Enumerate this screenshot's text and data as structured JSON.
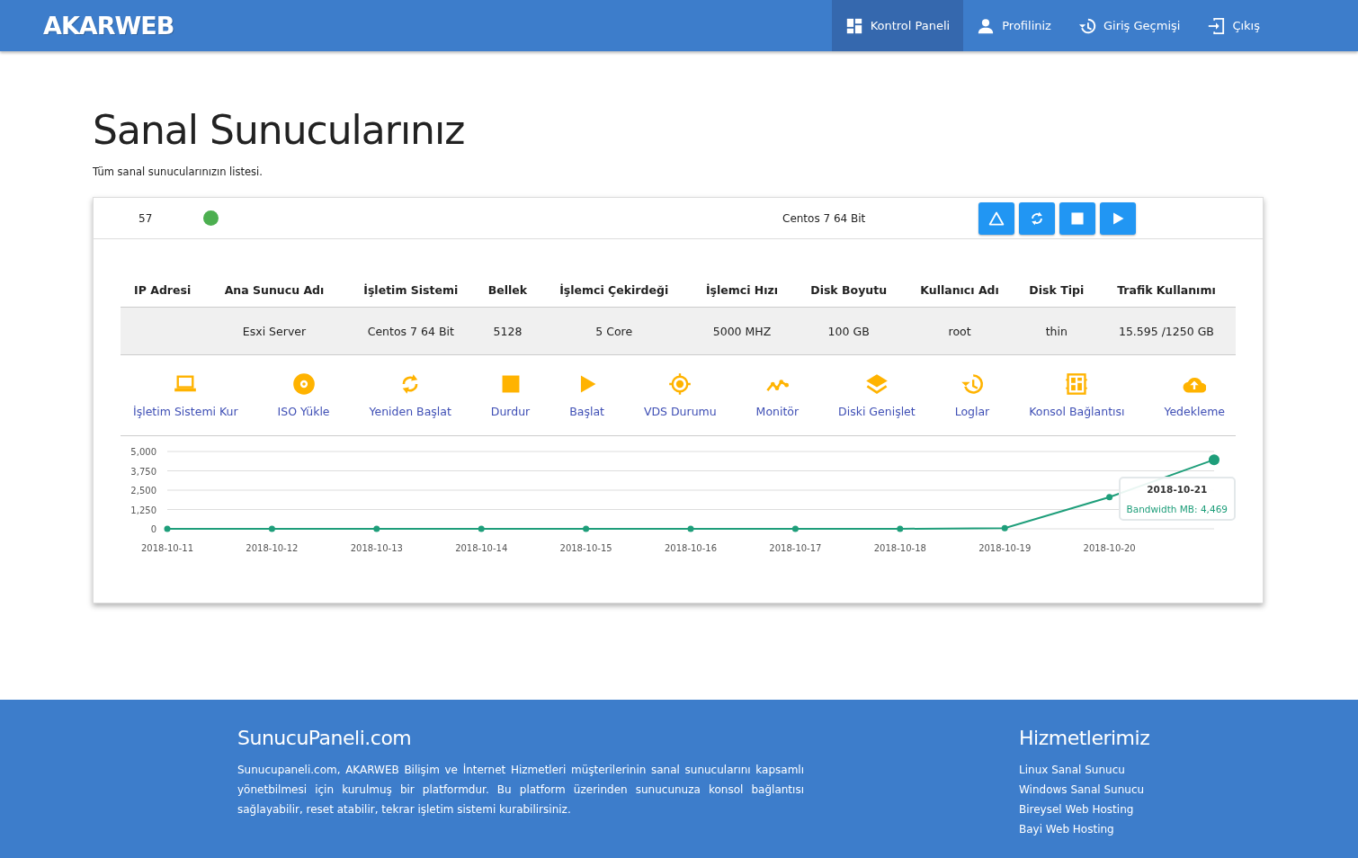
{
  "header": {
    "logo": "AKARWEB",
    "nav": [
      {
        "kind": "dashboard",
        "label": "Kontrol Paneli",
        "selected": true
      },
      {
        "kind": "person",
        "label": "Profiliniz",
        "selected": false
      },
      {
        "kind": "history",
        "label": "Giriş Geçmişi",
        "selected": false
      },
      {
        "kind": "logout",
        "label": "Çıkış",
        "selected": false
      }
    ]
  },
  "page": {
    "title": "Sanal Sunucularınız",
    "subtitle": "Tüm sanal sunucularınızın listesi."
  },
  "server": {
    "id": "57",
    "running": true,
    "os": "Centos 7 64 Bit",
    "buttons": [
      {
        "kind": "warning"
      },
      {
        "kind": "restart"
      },
      {
        "kind": "stop"
      },
      {
        "kind": "play"
      }
    ],
    "table": {
      "columns": [
        "IP Adresi",
        "Ana Sunucu Adı",
        "İşletim Sistemi",
        "Bellek",
        "İşlemci Çekirdeği",
        "İşlemci Hızı",
        "Disk Boyutu",
        "Kullanıcı Adı",
        "Disk Tipi",
        "Trafik Kullanımı"
      ],
      "row": [
        "Esxi Server",
        "Centos 7 64 Bit",
        "5128",
        "5 Core",
        "5000 MHZ",
        "100 GB",
        "root",
        "thin",
        "15.595 /1250 GB"
      ]
    },
    "actions": [
      {
        "kind": "laptop",
        "label": "İşletim Sistemi Kur"
      },
      {
        "kind": "disc",
        "label": "ISO Yükle"
      },
      {
        "kind": "restart",
        "label": "Yeniden Başlat"
      },
      {
        "kind": "stop",
        "label": "Durdur"
      },
      {
        "kind": "play",
        "label": "Başlat"
      },
      {
        "kind": "target",
        "label": "VDS Durumu"
      },
      {
        "kind": "chart",
        "label": "Monitör"
      },
      {
        "kind": "layers",
        "label": "Diski Genişlet"
      },
      {
        "kind": "history",
        "label": "Loglar"
      },
      {
        "kind": "console",
        "label": "Konsol Bağlantısı"
      },
      {
        "kind": "cloud",
        "label": "Yedekleme"
      }
    ],
    "chart_data": {
      "type": "line",
      "categories": [
        "2018-10-11",
        "2018-10-12",
        "2018-10-13",
        "2018-10-14",
        "2018-10-15",
        "2018-10-16",
        "2018-10-17",
        "2018-10-18",
        "2018-10-19",
        "2018-10-20",
        null
      ],
      "ylim": [
        0,
        5000
      ],
      "yticks": [
        {
          "value": 0,
          "label": "0"
        },
        {
          "value": 1250,
          "label": "1,250"
        },
        {
          "value": 2500,
          "label": "2,500"
        },
        {
          "value": 3750,
          "label": "3,750"
        },
        {
          "value": 5000,
          "label": "5,000"
        }
      ],
      "grid": true,
      "series": [
        {
          "color": "#1e9e7a",
          "marker": true,
          "values": [
            0,
            0,
            0,
            0,
            0,
            0,
            0,
            0,
            50,
            2050,
            4469
          ]
        }
      ]
    },
    "tooltip": {
      "title": "2018-10-21",
      "text": "Bandwidth MB: 4,469"
    }
  },
  "footer": {
    "about": {
      "title": "SunucuPaneli.com",
      "text": "Sunucupaneli.com, AKARWEB Bilişim ve İnternet Hizmetleri müşterilerinin sanal sunucularını kapsamlı yönetbilmesi için kurulmuş bir platformdur. Bu platform üzerinden sunucunuza konsol bağlantısı sağlayabilir, reset atabilir, tekrar işletim sistemi kurabilirsiniz."
    },
    "services": {
      "title": "Hizmetlerimiz",
      "links": [
        "Linux Sanal Sunucu",
        "Windows Sanal Sunucu",
        "Bireysel Web Hosting",
        "Bayi Web Hosting"
      ]
    }
  }
}
